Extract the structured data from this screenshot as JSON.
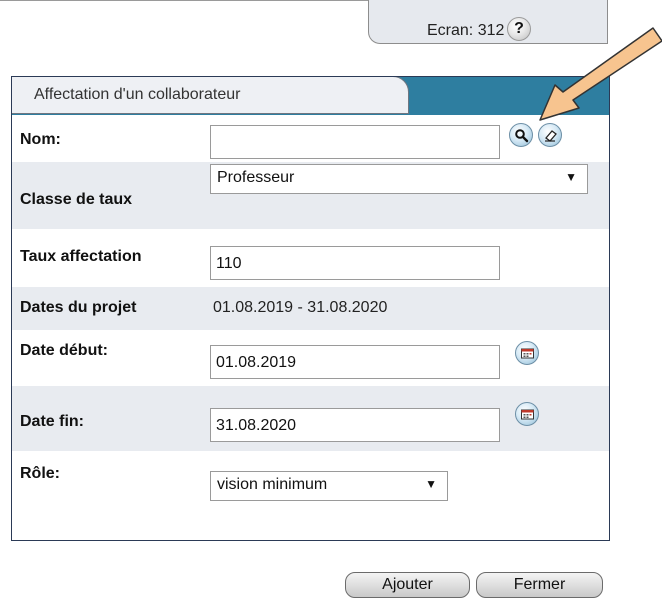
{
  "screen": {
    "label": "Ecran: 312",
    "help_glyph": "?"
  },
  "panel": {
    "title": "Affectation d'un collaborateur"
  },
  "form": {
    "nom": {
      "label": "Nom:",
      "value": ""
    },
    "classe": {
      "label": "Classe de taux",
      "selected": "Professeur"
    },
    "taux": {
      "label": "Taux affectation",
      "value": "110"
    },
    "dates_projet": {
      "label": "Dates du projet",
      "value": "01.08.2019 - 31.08.2020"
    },
    "date_debut": {
      "label": "Date début:",
      "value": "01.08.2019"
    },
    "date_fin": {
      "label": "Date fin:",
      "value": "31.08.2020"
    },
    "role": {
      "label": "Rôle:",
      "selected": "vision minimum"
    }
  },
  "buttons": {
    "add": "Ajouter",
    "close": "Fermer"
  },
  "icons": {
    "help": "help-icon",
    "search": "search-icon",
    "eraser": "eraser-icon",
    "calendar": "calendar-icon",
    "arrow": "annotation-arrow"
  },
  "colors": {
    "panel_header": "#2e7ea0",
    "row_shade": "#e8ebf0",
    "arrow_fill": "#f7c48f",
    "arrow_stroke": "#333333"
  }
}
